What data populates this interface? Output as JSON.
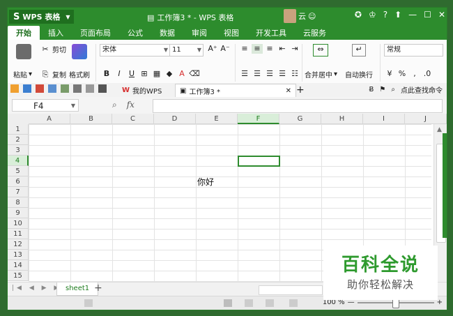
{
  "app": {
    "brand": "WPS 表格",
    "window_title": "工作簿3 * - WPS 表格",
    "user_name": "云"
  },
  "menu_tabs": [
    "开始",
    "插入",
    "页面布局",
    "公式",
    "数据",
    "审阅",
    "视图",
    "开发工具",
    "云服务"
  ],
  "ribbon": {
    "paste": "粘贴",
    "cut": "剪切",
    "copy": "复制",
    "format_painter": "格式刷",
    "font_name": "宋体",
    "font_size": "11",
    "merge_center": "合并居中",
    "wrap_text": "自动换行",
    "number_format": "常规",
    "percent": "%",
    "comma": ","
  },
  "doc_tabs": [
    {
      "label": "我的WPS",
      "active": false
    },
    {
      "label": "工作簿3 *",
      "active": true
    }
  ],
  "quick_search": "点此查找命令",
  "formula_bar": {
    "name_box": "F4",
    "fx": "fx",
    "value": ""
  },
  "grid": {
    "columns": [
      "A",
      "B",
      "C",
      "D",
      "E",
      "F",
      "G",
      "H",
      "I",
      "J"
    ],
    "rows": [
      "1",
      "2",
      "3",
      "4",
      "5",
      "6",
      "7",
      "8",
      "9",
      "10",
      "11",
      "12",
      "13",
      "14",
      "15"
    ],
    "selected_cell": "F4",
    "cells": [
      {
        "ref": "E6",
        "text": "你好"
      }
    ]
  },
  "sheets": [
    "sheet1"
  ],
  "status": {
    "zoom": "100 %"
  },
  "watermark": {
    "title": "百科全说",
    "subtitle": "助你轻松解决"
  },
  "colors": {
    "accent": "#2d8c2d",
    "selection": "#2e8b2e"
  }
}
